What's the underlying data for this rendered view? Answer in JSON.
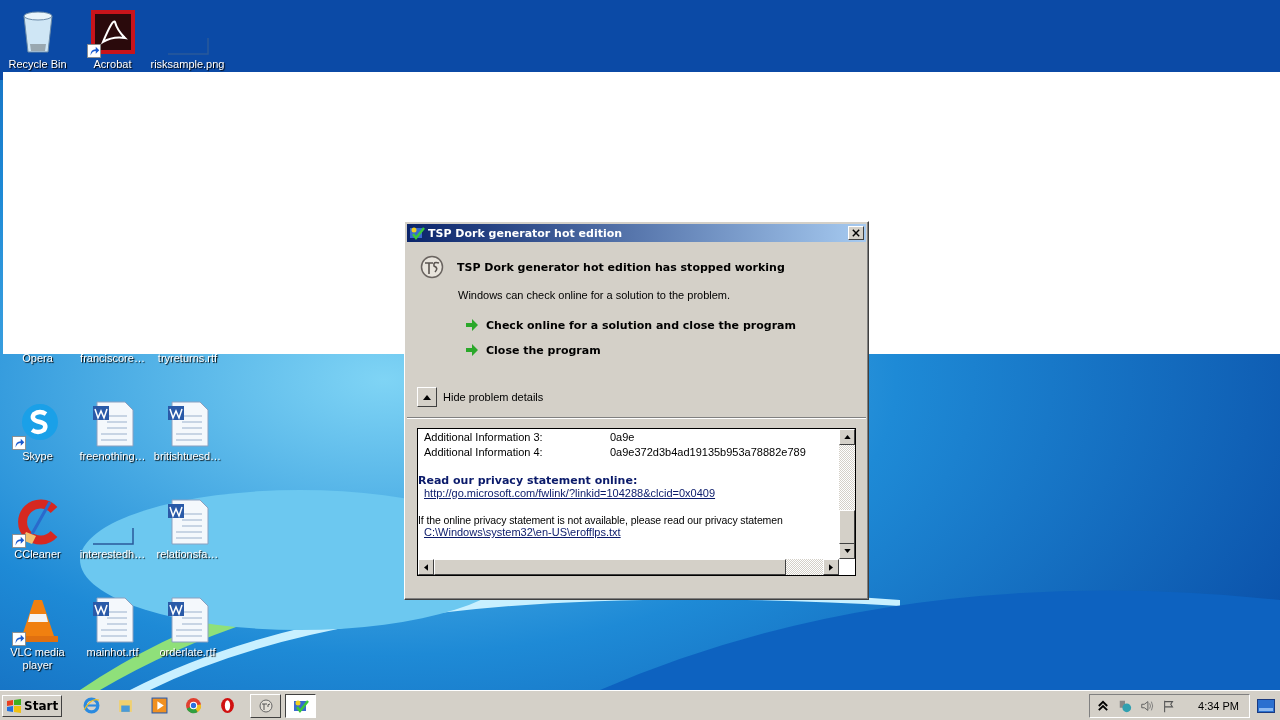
{
  "desktop_icons": [
    {
      "label": "Recycle Bin",
      "kind": "recycle-bin",
      "shortcut": false
    },
    {
      "label": "Acrobat",
      "kind": "acrobat",
      "shortcut": true
    },
    {
      "label": "risksample.png",
      "kind": "blank",
      "shortcut": false
    },
    {
      "label": "Opera",
      "kind": "hidden"
    },
    {
      "label": "franciscore…",
      "kind": "hidden"
    },
    {
      "label": "tryreturns.rtf",
      "kind": "hidden"
    },
    {
      "label": "Skype",
      "kind": "skype",
      "shortcut": true
    },
    {
      "label": "freenothing…",
      "kind": "word",
      "shortcut": false
    },
    {
      "label": "britishtuesd…",
      "kind": "word",
      "shortcut": false
    },
    {
      "label": "CCleaner",
      "kind": "ccleaner",
      "shortcut": true
    },
    {
      "label": "interestedh…",
      "kind": "blank",
      "shortcut": false
    },
    {
      "label": "relationsfa…",
      "kind": "word",
      "shortcut": false
    },
    {
      "label": "VLC media player",
      "kind": "vlc",
      "shortcut": true
    },
    {
      "label": "mainhot.rtf",
      "kind": "word",
      "shortcut": false
    },
    {
      "label": "orderlate.rtf",
      "kind": "word",
      "shortcut": false
    }
  ],
  "dialog": {
    "title": "TSP Dork generator hot edition",
    "heading": "TSP Dork generator hot edition has stopped working",
    "message": "Windows can check online for a solution to the problem.",
    "options": [
      "Check online for a solution and close the program",
      "Close the program"
    ],
    "details_toggle": "Hide problem details",
    "details": {
      "rows": [
        {
          "label": "Additional Information 3:",
          "value": "0a9e"
        },
        {
          "label": "Additional Information 4:",
          "value": "0a9e372d3b4ad19135b953a78882e789"
        }
      ],
      "privacy_heading": "Read our privacy statement online:",
      "privacy_link": "http://go.microsoft.com/fwlink/?linkid=104288&clcid=0x0409",
      "offline_note": "If the online privacy statement is not available, please read our privacy statemen",
      "offline_link": "C:\\Windows\\system32\\en-US\\erofflps.txt"
    }
  },
  "taskbar": {
    "start": "Start",
    "quick_launch": [
      {
        "kind": "ie"
      },
      {
        "kind": "explorer"
      },
      {
        "kind": "media"
      },
      {
        "kind": "chrome"
      },
      {
        "kind": "opera"
      }
    ],
    "tasks": [
      {
        "kind": "crash-app",
        "selected": false
      },
      {
        "kind": "error-report",
        "selected": true
      }
    ],
    "clock": "4:34 PM"
  }
}
